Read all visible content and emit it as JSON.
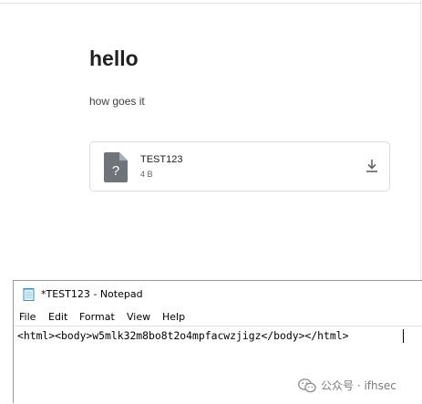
{
  "message": {
    "title": "hello",
    "body": "how goes it",
    "attachment": {
      "file_name": "TEST123",
      "file_size": "4 B",
      "file_icon": "unknown-file-icon",
      "download_icon": "download-icon"
    }
  },
  "notepad": {
    "title": "*TEST123 - Notepad",
    "app_icon": "notepad-icon",
    "menu": {
      "file": "File",
      "edit": "Edit",
      "format": "Format",
      "view": "View",
      "help": "Help"
    },
    "content": "<html><body>w5mlk32m8bo8t2o4mpfacwzjigz</body></html>"
  },
  "watermark": {
    "text": "公众号 · ifhsec",
    "icon": "wechat-icon"
  },
  "colors": {
    "file_icon": "#6f737a",
    "card_border": "#dadce0",
    "title_text": "#202124"
  }
}
